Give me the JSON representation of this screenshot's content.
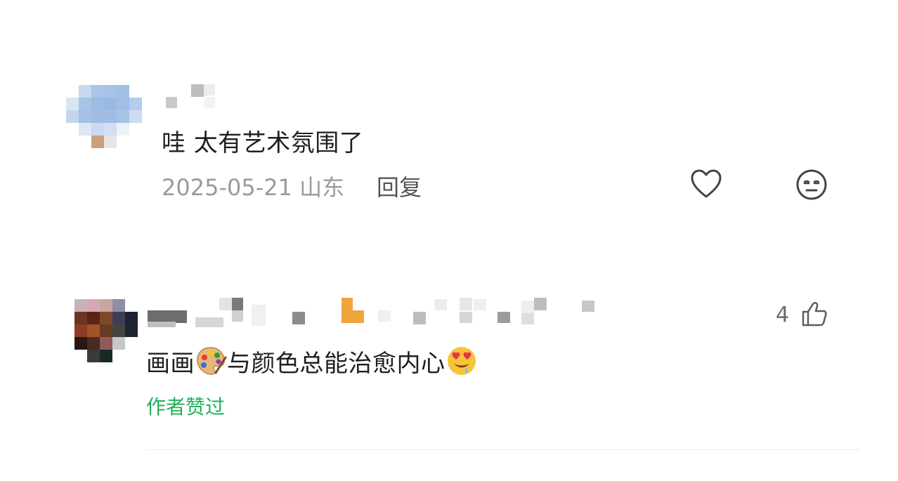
{
  "comments": [
    {
      "text": "哇 太有艺术氛围了",
      "date": "2025-05-21",
      "location": "山东",
      "reply_label": "回复"
    },
    {
      "text_before": "画画",
      "text_after": "与颜色总能治愈内心",
      "like_count": "4",
      "author_liked": "作者赞过"
    }
  ],
  "colors": {
    "text": "#1f1f1f",
    "meta": "#9a9a9a",
    "author_liked": "#1fb25a",
    "name_accent": "#f0a43a"
  },
  "icons": {
    "like": "heart-outline-icon",
    "dislike": "neutral-face-icon",
    "thumb": "thumbs-up-icon",
    "palette": "artist-palette-emoji",
    "heart_eyes": "heart-eyes-emoji"
  }
}
